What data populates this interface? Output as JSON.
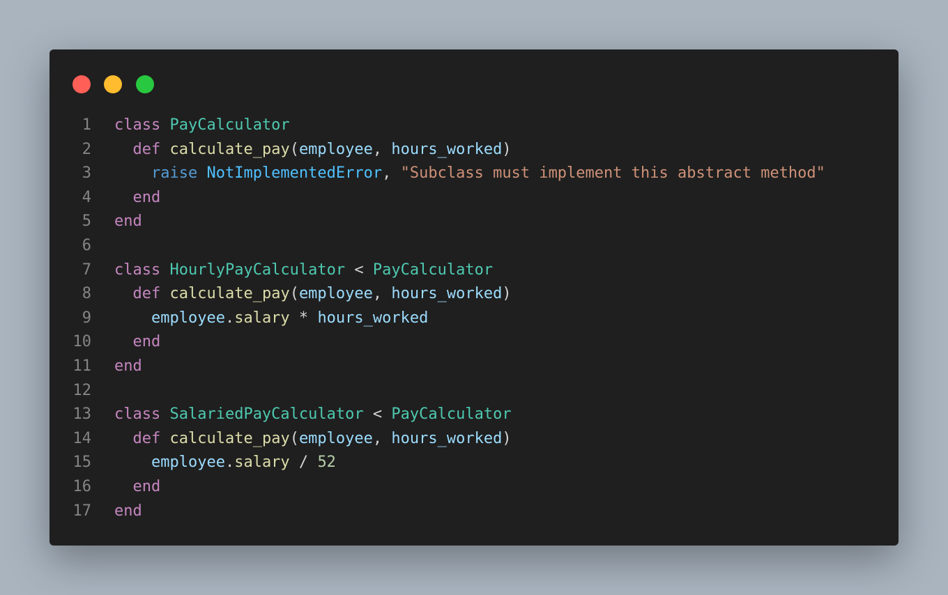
{
  "window": {
    "controls": [
      {
        "name": "close",
        "color": "#ff5f57"
      },
      {
        "name": "minimize",
        "color": "#febc2e"
      },
      {
        "name": "maximize",
        "color": "#28c840"
      }
    ]
  },
  "code": {
    "language": "ruby",
    "lines": [
      {
        "n": "1",
        "tokens": [
          [
            "kw",
            "class"
          ],
          [
            "op",
            " "
          ],
          [
            "cls",
            "PayCalculator"
          ]
        ]
      },
      {
        "n": "2",
        "tokens": [
          [
            "op",
            "  "
          ],
          [
            "kw",
            "def"
          ],
          [
            "op",
            " "
          ],
          [
            "fn",
            "calculate_pay"
          ],
          [
            "op",
            "("
          ],
          [
            "var",
            "employee"
          ],
          [
            "op",
            ", "
          ],
          [
            "var",
            "hours_worked"
          ],
          [
            "op",
            ")"
          ]
        ]
      },
      {
        "n": "3",
        "tokens": [
          [
            "op",
            "    "
          ],
          [
            "kw2",
            "raise"
          ],
          [
            "op",
            " "
          ],
          [
            "cls2",
            "NotImplementedError"
          ],
          [
            "op",
            ", "
          ],
          [
            "str",
            "\"Subclass must implement this abstract method\""
          ]
        ]
      },
      {
        "n": "4",
        "tokens": [
          [
            "op",
            "  "
          ],
          [
            "kw",
            "end"
          ]
        ]
      },
      {
        "n": "5",
        "tokens": [
          [
            "kw",
            "end"
          ]
        ]
      },
      {
        "n": "6",
        "tokens": []
      },
      {
        "n": "7",
        "tokens": [
          [
            "kw",
            "class"
          ],
          [
            "op",
            " "
          ],
          [
            "cls",
            "HourlyPayCalculator"
          ],
          [
            "op",
            " < "
          ],
          [
            "cls",
            "PayCalculator"
          ]
        ]
      },
      {
        "n": "8",
        "tokens": [
          [
            "op",
            "  "
          ],
          [
            "kw",
            "def"
          ],
          [
            "op",
            " "
          ],
          [
            "fn",
            "calculate_pay"
          ],
          [
            "op",
            "("
          ],
          [
            "var",
            "employee"
          ],
          [
            "op",
            ", "
          ],
          [
            "var",
            "hours_worked"
          ],
          [
            "op",
            ")"
          ]
        ]
      },
      {
        "n": "9",
        "tokens": [
          [
            "op",
            "    "
          ],
          [
            "var",
            "employee"
          ],
          [
            "op",
            "."
          ],
          [
            "fn",
            "salary"
          ],
          [
            "op",
            " * "
          ],
          [
            "var",
            "hours_worked"
          ]
        ]
      },
      {
        "n": "10",
        "tokens": [
          [
            "op",
            "  "
          ],
          [
            "kw",
            "end"
          ]
        ]
      },
      {
        "n": "11",
        "tokens": [
          [
            "kw",
            "end"
          ]
        ]
      },
      {
        "n": "12",
        "tokens": []
      },
      {
        "n": "13",
        "tokens": [
          [
            "kw",
            "class"
          ],
          [
            "op",
            " "
          ],
          [
            "cls",
            "SalariedPayCalculator"
          ],
          [
            "op",
            " < "
          ],
          [
            "cls",
            "PayCalculator"
          ]
        ]
      },
      {
        "n": "14",
        "tokens": [
          [
            "op",
            "  "
          ],
          [
            "kw",
            "def"
          ],
          [
            "op",
            " "
          ],
          [
            "fn",
            "calculate_pay"
          ],
          [
            "op",
            "("
          ],
          [
            "var",
            "employee"
          ],
          [
            "op",
            ", "
          ],
          [
            "var",
            "hours_worked"
          ],
          [
            "op",
            ")"
          ]
        ]
      },
      {
        "n": "15",
        "tokens": [
          [
            "op",
            "    "
          ],
          [
            "var",
            "employee"
          ],
          [
            "op",
            "."
          ],
          [
            "fn",
            "salary"
          ],
          [
            "op",
            " / "
          ],
          [
            "num",
            "52"
          ]
        ]
      },
      {
        "n": "16",
        "tokens": [
          [
            "op",
            "  "
          ],
          [
            "kw",
            "end"
          ]
        ]
      },
      {
        "n": "17",
        "tokens": [
          [
            "kw",
            "end"
          ]
        ]
      }
    ]
  },
  "colors": {
    "background": "#a9b4bf",
    "editor": "#1f1f1f",
    "keyword": "#c586c0",
    "class": "#4ec9b0",
    "function": "#dcdcaa",
    "variable": "#9cdcfe",
    "string": "#ce9178",
    "builtin": "#569cd6",
    "exception": "#4fc1ff",
    "number": "#b5cea8",
    "line_number": "#858585"
  }
}
